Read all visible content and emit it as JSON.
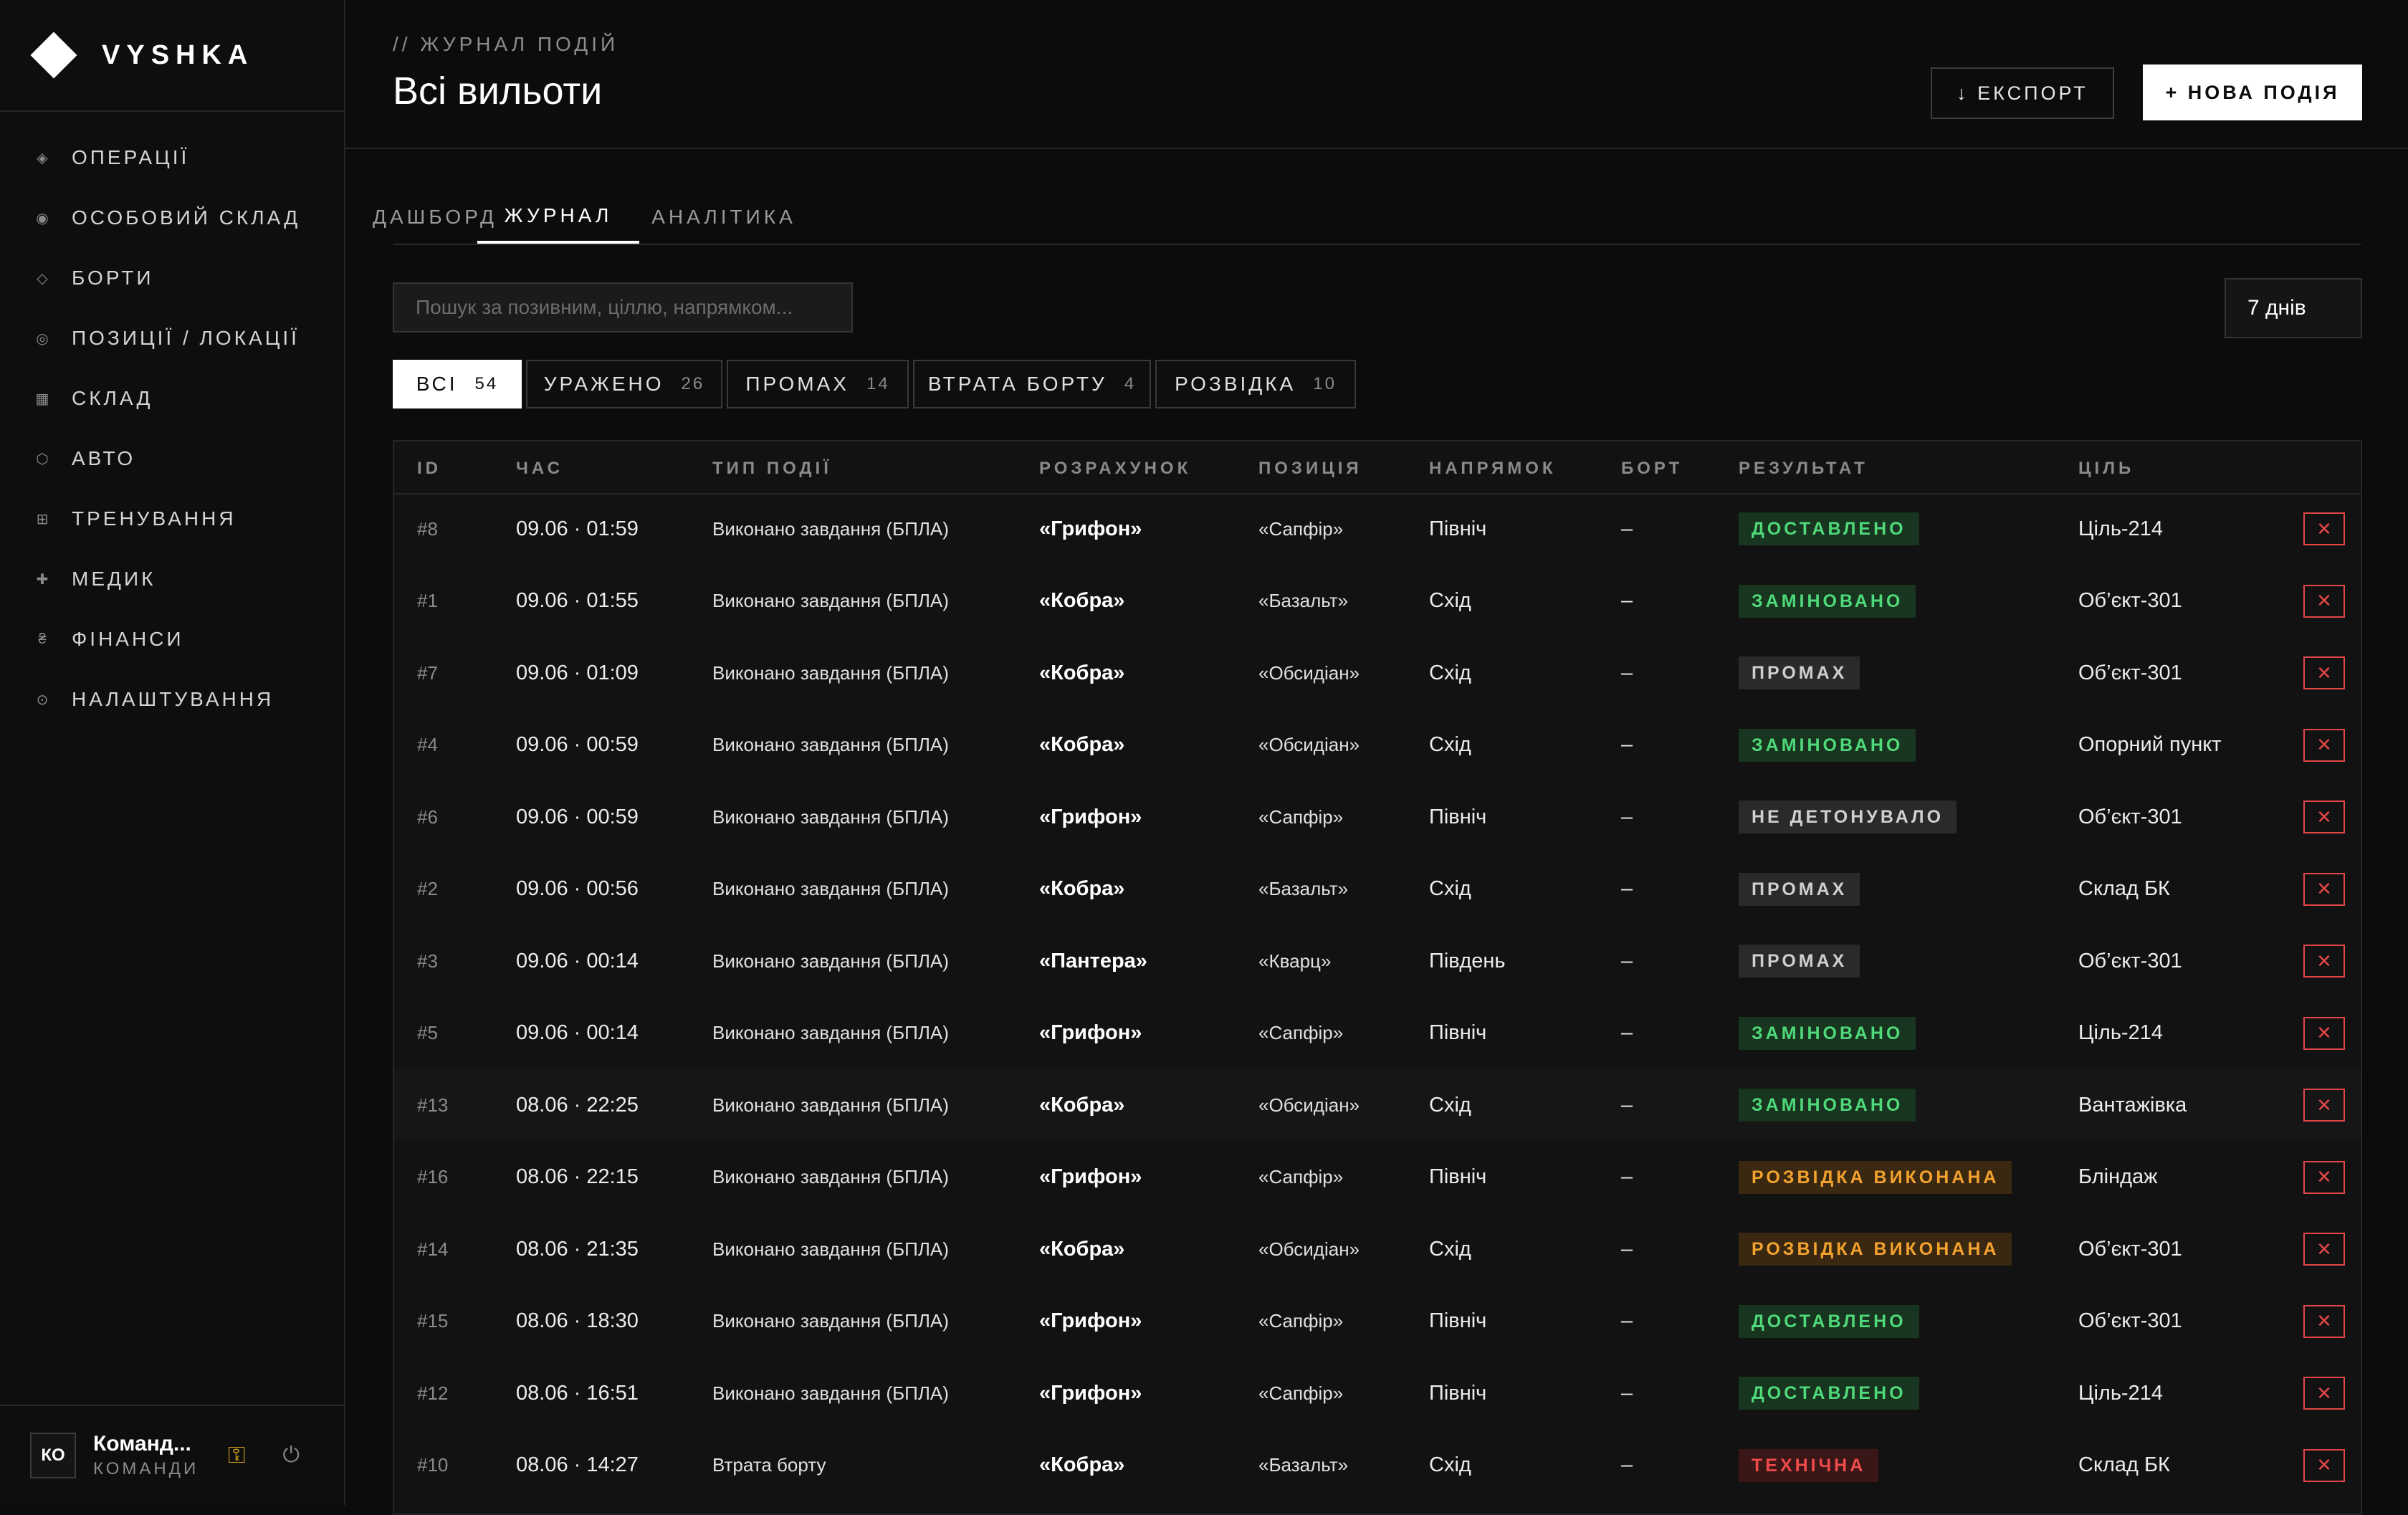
{
  "brand": {
    "name": "VYSHKA"
  },
  "sidebar": {
    "items": [
      {
        "icon": "◈",
        "label": "ОПЕРАЦІЇ"
      },
      {
        "icon": "◉",
        "label": "ОСОБОВИЙ СКЛАД"
      },
      {
        "icon": "◇",
        "label": "БОРТИ"
      },
      {
        "icon": "◎",
        "label": "ПОЗИЦІЇ / ЛОКАЦІЇ"
      },
      {
        "icon": "▦",
        "label": "СКЛАД"
      },
      {
        "icon": "⬡",
        "label": "АВТО"
      },
      {
        "icon": "⊞",
        "label": "ТРЕНУВАННЯ"
      },
      {
        "icon": "✚",
        "label": "МЕДИК"
      },
      {
        "icon": "₴",
        "label": "ФІНАНСИ"
      },
      {
        "icon": "⊙",
        "label": "НАЛАШТУВАННЯ"
      }
    ]
  },
  "user": {
    "initials": "КО",
    "name": "Команд...",
    "role": "КОМАНДИ",
    "key_icon": "⚿",
    "power_icon": "⏻"
  },
  "header": {
    "breadcrumb": "// ЖУРНАЛ ПОДІЙ",
    "title": "Всі вильоти",
    "export_label": "↓ ЕКСПОРТ",
    "new_label": "+ НОВА ПОДІЯ"
  },
  "tabs": [
    {
      "label": "ДАШБОРД"
    },
    {
      "label": "ЖУРНАЛ"
    },
    {
      "label": "АНАЛІТИКА"
    }
  ],
  "search": {
    "placeholder": "Пошук за позивним, ціллю, напрямком..."
  },
  "period": {
    "value": "7 днів"
  },
  "filters": [
    {
      "label": "ВСІ",
      "count": "54"
    },
    {
      "label": "УРАЖЕНО",
      "count": "26"
    },
    {
      "label": "ПРОМАХ",
      "count": "14"
    },
    {
      "label": "ВТРАТА БОРТУ",
      "count": "4"
    },
    {
      "label": "РОЗВІДКА",
      "count": "10"
    }
  ],
  "table": {
    "columns": [
      "ID",
      "ЧАС",
      "ТИП ПОДІЇ",
      "РОЗРАХУНОК",
      "ПОЗИЦІЯ",
      "НАПРЯМОК",
      "БОРТ",
      "РЕЗУЛЬТАТ",
      "ЦІЛЬ"
    ],
    "delete_icon": "✕",
    "colors": {
      "green": "#4fd97a",
      "gray": "#cfcfcf",
      "orange": "#f4a22e",
      "red": "#f04b4b"
    },
    "rows": [
      {
        "id": "#8",
        "time": "09.06 · 01:59",
        "type": "Виконано завдання (БПЛА)",
        "calc": "«Грифон»",
        "pos": "«Сапфір»",
        "dir": "Північ",
        "board": "–",
        "result": "ДОСТАВЛЕНО",
        "result_color": "green",
        "target": "Ціль-214"
      },
      {
        "id": "#1",
        "time": "09.06 · 01:55",
        "type": "Виконано завдання (БПЛА)",
        "calc": "«Кобра»",
        "pos": "«Базальт»",
        "dir": "Схід",
        "board": "–",
        "result": "ЗАМІНОВАНО",
        "result_color": "green",
        "target": "Об’єкт-301"
      },
      {
        "id": "#7",
        "time": "09.06 · 01:09",
        "type": "Виконано завдання (БПЛА)",
        "calc": "«Кобра»",
        "pos": "«Обсидіан»",
        "dir": "Схід",
        "board": "–",
        "result": "ПРОМАХ",
        "result_color": "gray",
        "target": "Об’єкт-301"
      },
      {
        "id": "#4",
        "time": "09.06 · 00:59",
        "type": "Виконано завдання (БПЛА)",
        "calc": "«Кобра»",
        "pos": "«Обсидіан»",
        "dir": "Схід",
        "board": "–",
        "result": "ЗАМІНОВАНО",
        "result_color": "green",
        "target": "Опорний пункт"
      },
      {
        "id": "#6",
        "time": "09.06 · 00:59",
        "type": "Виконано завдання (БПЛА)",
        "calc": "«Грифон»",
        "pos": "«Сапфір»",
        "dir": "Північ",
        "board": "–",
        "result": "НЕ ДЕТОНУВАЛО",
        "result_color": "gray",
        "target": "Об’єкт-301"
      },
      {
        "id": "#2",
        "time": "09.06 · 00:56",
        "type": "Виконано завдання (БПЛА)",
        "calc": "«Кобра»",
        "pos": "«Базальт»",
        "dir": "Схід",
        "board": "–",
        "result": "ПРОМАХ",
        "result_color": "gray",
        "target": "Склад БК"
      },
      {
        "id": "#3",
        "time": "09.06 · 00:14",
        "type": "Виконано завдання (БПЛА)",
        "calc": "«Пантера»",
        "pos": "«Кварц»",
        "dir": "Південь",
        "board": "–",
        "result": "ПРОМАХ",
        "result_color": "gray",
        "target": "Об’єкт-301"
      },
      {
        "id": "#5",
        "time": "09.06 · 00:14",
        "type": "Виконано завдання (БПЛА)",
        "calc": "«Грифон»",
        "pos": "«Сапфір»",
        "dir": "Північ",
        "board": "–",
        "result": "ЗАМІНОВАНО",
        "result_color": "green",
        "target": "Ціль-214"
      },
      {
        "id": "#13",
        "time": "08.06 · 22:25",
        "type": "Виконано завдання (БПЛА)",
        "calc": "«Кобра»",
        "pos": "«Обсидіан»",
        "dir": "Схід",
        "board": "–",
        "result": "ЗАМІНОВАНО",
        "result_color": "green",
        "target": "Вантажівка"
      },
      {
        "id": "#16",
        "time": "08.06 · 22:15",
        "type": "Виконано завдання (БПЛА)",
        "calc": "«Грифон»",
        "pos": "«Сапфір»",
        "dir": "Північ",
        "board": "–",
        "result": "РОЗВІДКА ВИКОНАНА",
        "result_color": "orange",
        "target": "Бліндаж"
      },
      {
        "id": "#14",
        "time": "08.06 · 21:35",
        "type": "Виконано завдання (БПЛА)",
        "calc": "«Кобра»",
        "pos": "«Обсидіан»",
        "dir": "Схід",
        "board": "–",
        "result": "РОЗВІДКА ВИКОНАНА",
        "result_color": "orange",
        "target": "Об’єкт-301"
      },
      {
        "id": "#15",
        "time": "08.06 · 18:30",
        "type": "Виконано завдання (БПЛА)",
        "calc": "«Грифон»",
        "pos": "«Сапфір»",
        "dir": "Північ",
        "board": "–",
        "result": "ДОСТАВЛЕНО",
        "result_color": "green",
        "target": "Об’єкт-301"
      },
      {
        "id": "#12",
        "time": "08.06 · 16:51",
        "type": "Виконано завдання (БПЛА)",
        "calc": "«Грифон»",
        "pos": "«Сапфір»",
        "dir": "Північ",
        "board": "–",
        "result": "ДОСТАВЛЕНО",
        "result_color": "green",
        "target": "Ціль-214"
      },
      {
        "id": "#10",
        "time": "08.06 · 14:27",
        "type": "Втрата борту",
        "calc": "«Кобра»",
        "pos": "«Базальт»",
        "dir": "Схід",
        "board": "–",
        "result": "ТЕХНІЧНА",
        "result_color": "red",
        "target": "Склад БК"
      }
    ]
  }
}
